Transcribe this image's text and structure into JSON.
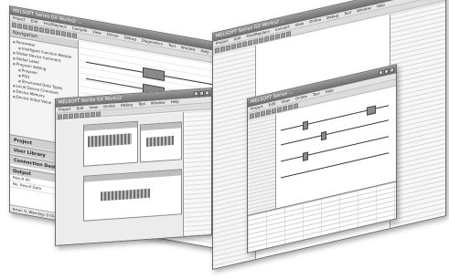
{
  "window_back": {
    "title": "MELSOFT Series GX Works2 ...",
    "menu": [
      "Project",
      "Edit",
      "Find/Replace",
      "Compile",
      "View",
      "Online",
      "Debug",
      "Diagnostics",
      "Tool",
      "Window",
      "Help"
    ],
    "nav_header": "Navigation",
    "tree": [
      "Parameter",
      "Intelligent Function Module",
      "Global Device Comment",
      "Global Label",
      "Program Setting",
      "Program",
      "POU",
      "Structured Data Types",
      "Local Device Comment",
      "Device Memory",
      "Device Initial Value"
    ],
    "nav_buttons": [
      "Project",
      "User Library",
      "Connection Destination"
    ],
    "output_header": "Output",
    "output_label": "Result All",
    "output_cols": "No.  Result  Data",
    "status": "Error: 0, Warning: 0 Checked"
  },
  "window_mid": {
    "title": "MELSOFT Series GX Works2",
    "menu": [
      "Project",
      "Edit",
      "View",
      "Online",
      "Debug",
      "Tool",
      "Window",
      "Help"
    ]
  },
  "window_right": {
    "title": "MELSOFT Series GX Works2 ...",
    "menu": [
      "Project",
      "Edit",
      "Find/Replace",
      "Convert",
      "View",
      "Online",
      "Debug",
      "Tool",
      "Window",
      "Help"
    ]
  },
  "window_front": {
    "title": "MELSOFT Series ...",
    "menu": [
      "Project",
      "Edit",
      "View",
      "Online",
      "Tool",
      "Help"
    ]
  }
}
